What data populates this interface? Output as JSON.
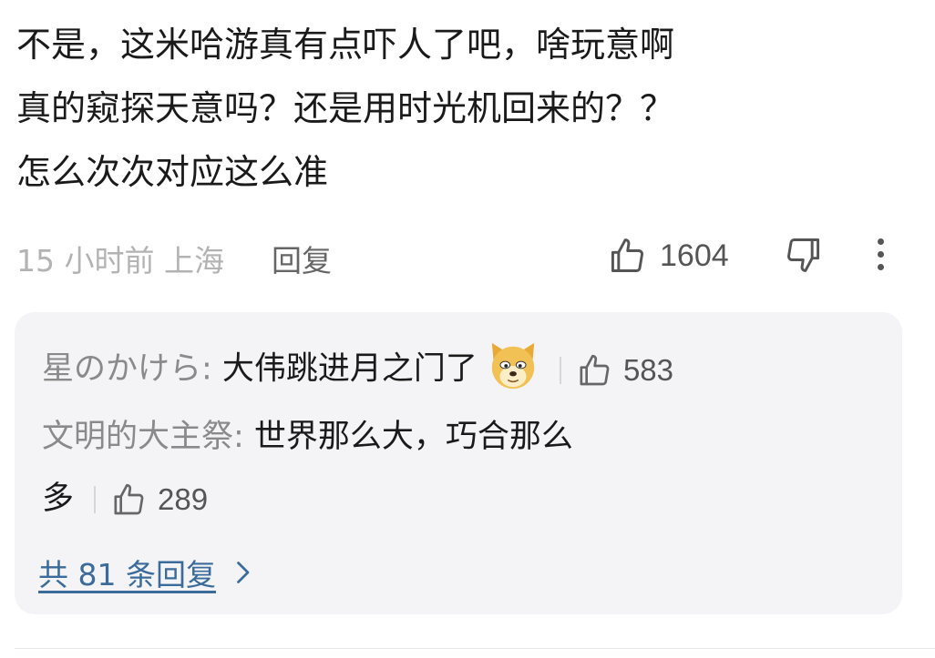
{
  "comment": {
    "lines": [
      "不是，这米哈游真有点吓人了吧，啥玩意啊",
      "真的窥探天意吗？还是用时光机回来的？？",
      "怎么次次对应这么准"
    ],
    "time": "15 小时前 上海",
    "reply_label": "回复",
    "like_count": "1604"
  },
  "replies": [
    {
      "author": "星のかけら:",
      "text": " 大伟跳进月之门了",
      "emoji": "doge-emoji",
      "like_count": "583"
    },
    {
      "author": "文明的大主祭:",
      "text_line1": " 世界那么大，巧合那么",
      "text_line2": "多",
      "like_count": "289"
    }
  ],
  "more_replies_label": "共 81 条回复",
  "icons": {
    "like": "thumbs-up-icon",
    "dislike": "thumbs-down-icon",
    "more": "more-vertical-icon",
    "chevron": "chevron-right-icon"
  },
  "colors": {
    "text": "#1a1a1a",
    "muted": "#b3b3b3",
    "author": "#8a8a8a",
    "link": "#3a6b9a",
    "reply_bg": "#f4f4f6"
  }
}
